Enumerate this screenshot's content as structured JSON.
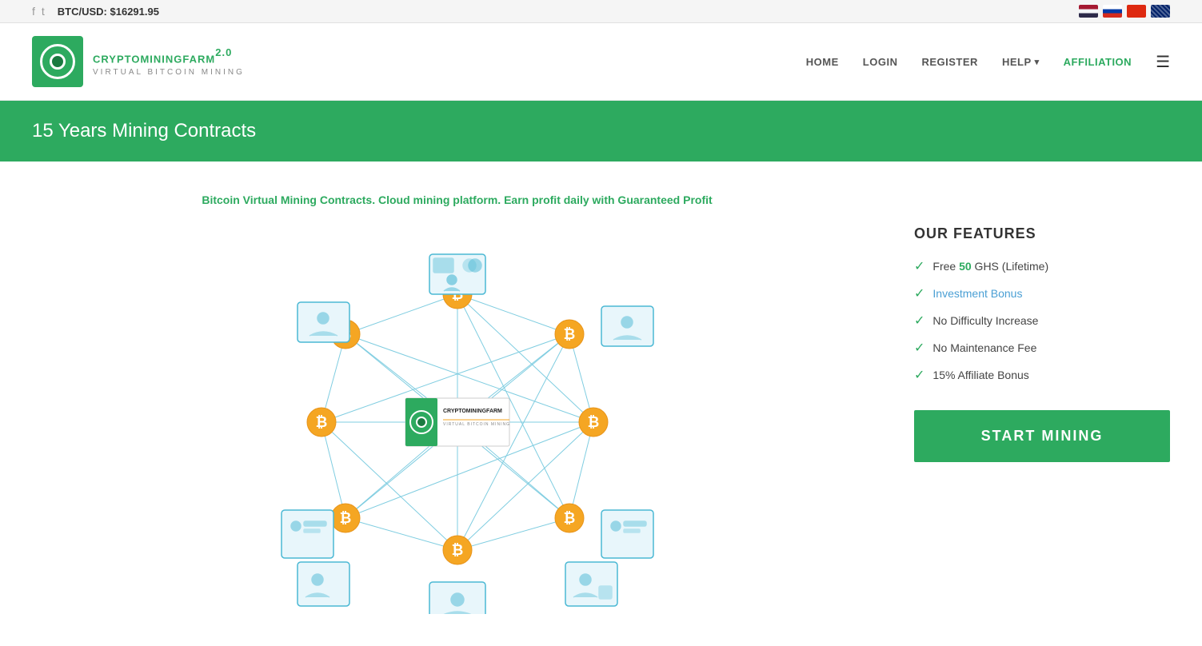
{
  "topbar": {
    "btc_label": "BTC/USD:",
    "btc_price": "$16291.95",
    "flags": [
      "TH",
      "RU",
      "CN",
      "UK"
    ]
  },
  "header": {
    "logo_title": "CRYPTOMININGFARM",
    "logo_version": "2.0",
    "logo_subtitle": "VIRTUAL BITCOIN MINING",
    "nav": {
      "home": "HOME",
      "login": "LOGIN",
      "register": "REGISTER",
      "help": "HELP",
      "affiliation": "AFFILIATION"
    }
  },
  "banner": {
    "title": "15 Years Mining Contracts"
  },
  "main": {
    "tagline_start": "Bitcoin Virtual Mining Contracts. Cloud mining platform.",
    "tagline_highlight": "Earn profit daily with Guaranteed Profit",
    "features_title": "OUR FEATURES",
    "features": [
      {
        "id": "free-ghs",
        "text_before": "Free ",
        "highlight": "50",
        "text_after": " GHS (Lifetime)"
      },
      {
        "id": "investment-bonus",
        "link_text": "Investment Bonus"
      },
      {
        "id": "no-difficulty",
        "text": "No Difficulty Increase"
      },
      {
        "id": "no-maintenance",
        "text": "No Maintenance Fee"
      },
      {
        "id": "affiliate-bonus",
        "text": "15% Affiliate Bonus"
      }
    ],
    "start_mining_label": "START MINING"
  }
}
